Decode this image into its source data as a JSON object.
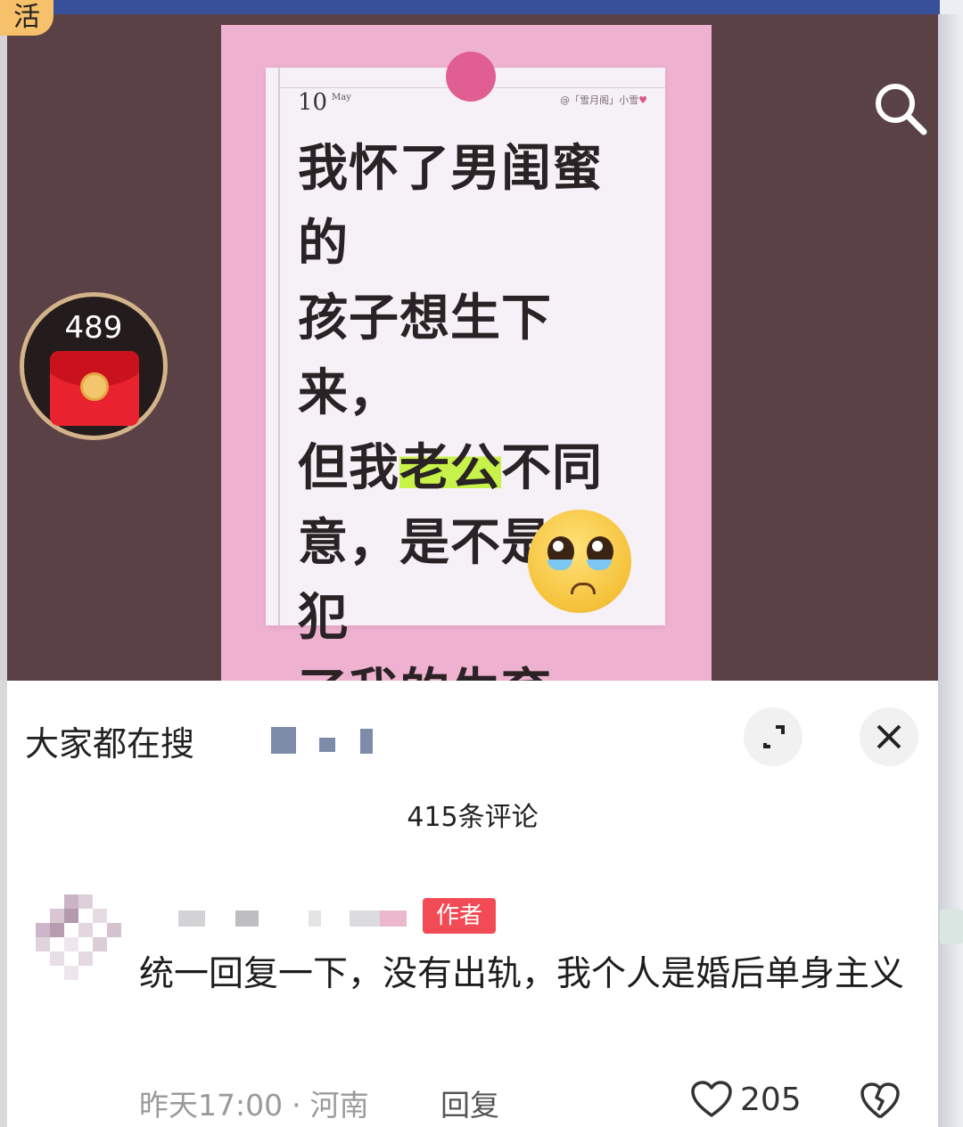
{
  "corner_tag": "活",
  "poster": {
    "date_day": "10",
    "date_month": "May",
    "author_tag": "@「雪月阁」小雪",
    "headline_lines": [
      [
        "我怀了男闺蜜的"
      ],
      [
        "孩子想生下来，"
      ],
      [
        "但我",
        "老公",
        "不同"
      ],
      [
        "意，是不是侵犯"
      ],
      [
        "了我的",
        "生育权",
        "?!"
      ]
    ]
  },
  "red_packet": {
    "count": "489"
  },
  "icons": {
    "search": "search-icon",
    "expand": "expand-icon",
    "close": "close-icon",
    "like": "heart-icon",
    "dislike": "broken-heart-icon"
  },
  "comments_panel": {
    "search_prefix": "大家都在搜",
    "count_label": "415条评论",
    "comment": {
      "badge": "作者",
      "text": "统一回复一下，没有出轨，我个人是婚后单身主义",
      "time": "昨天17:00",
      "separator": "·",
      "location": "河南",
      "reply_label": "回复",
      "likes": "205"
    }
  },
  "colors": {
    "video_bg": "#5a4145",
    "poster_pink": "#efb1d0",
    "highlight_green": "#c6f24a",
    "highlight_yellow": "#f8f06a",
    "badge_red": "#f24b55"
  }
}
